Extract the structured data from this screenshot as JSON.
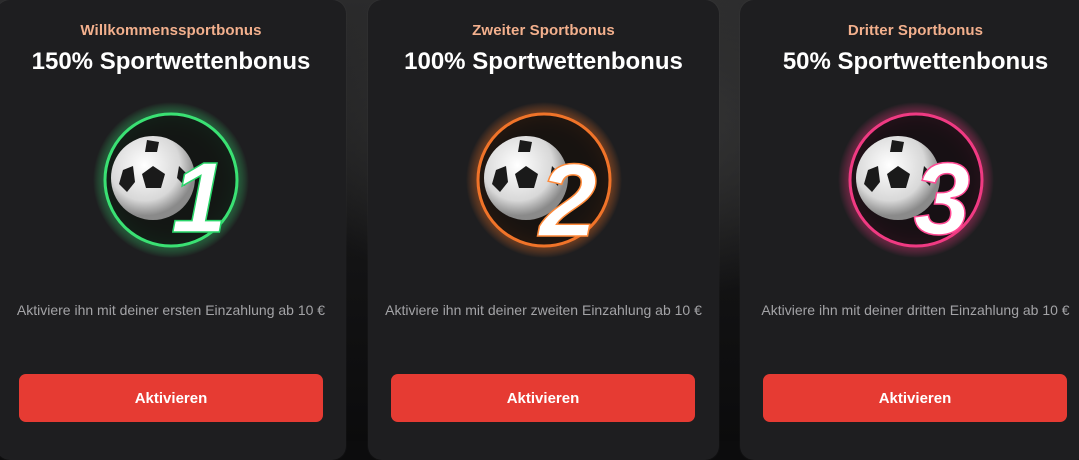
{
  "colors": {
    "accent": "#e63b33",
    "subtitle": "#f3b08d",
    "card_bg": "#1e1e20",
    "text_muted": "#a3a3a6",
    "glow_green": "#3df07a",
    "glow_orange": "#ff7a2a",
    "glow_pink": "#ff3d8a"
  },
  "cards": [
    {
      "subtitle": "Willkommenssportbonus",
      "title": "150% Sportwettenbonus",
      "number": "1",
      "icon": "soccer-ball-number-1-icon",
      "description": "Aktiviere ihn mit deiner ersten Einzahlung ab 10 €",
      "button": "Aktivieren"
    },
    {
      "subtitle": "Zweiter Sportbonus",
      "title": "100% Sportwettenbonus",
      "number": "2",
      "icon": "soccer-ball-number-2-icon",
      "description": "Aktiviere ihn mit deiner zweiten Einzahlung ab 10 €",
      "button": "Aktivieren"
    },
    {
      "subtitle": "Dritter Sportbonus",
      "title": "50% Sportwettenbonus",
      "number": "3",
      "icon": "soccer-ball-number-3-icon",
      "description": "Aktiviere ihn mit deiner dritten Einzahlung ab 10 €",
      "button": "Aktivieren"
    }
  ]
}
